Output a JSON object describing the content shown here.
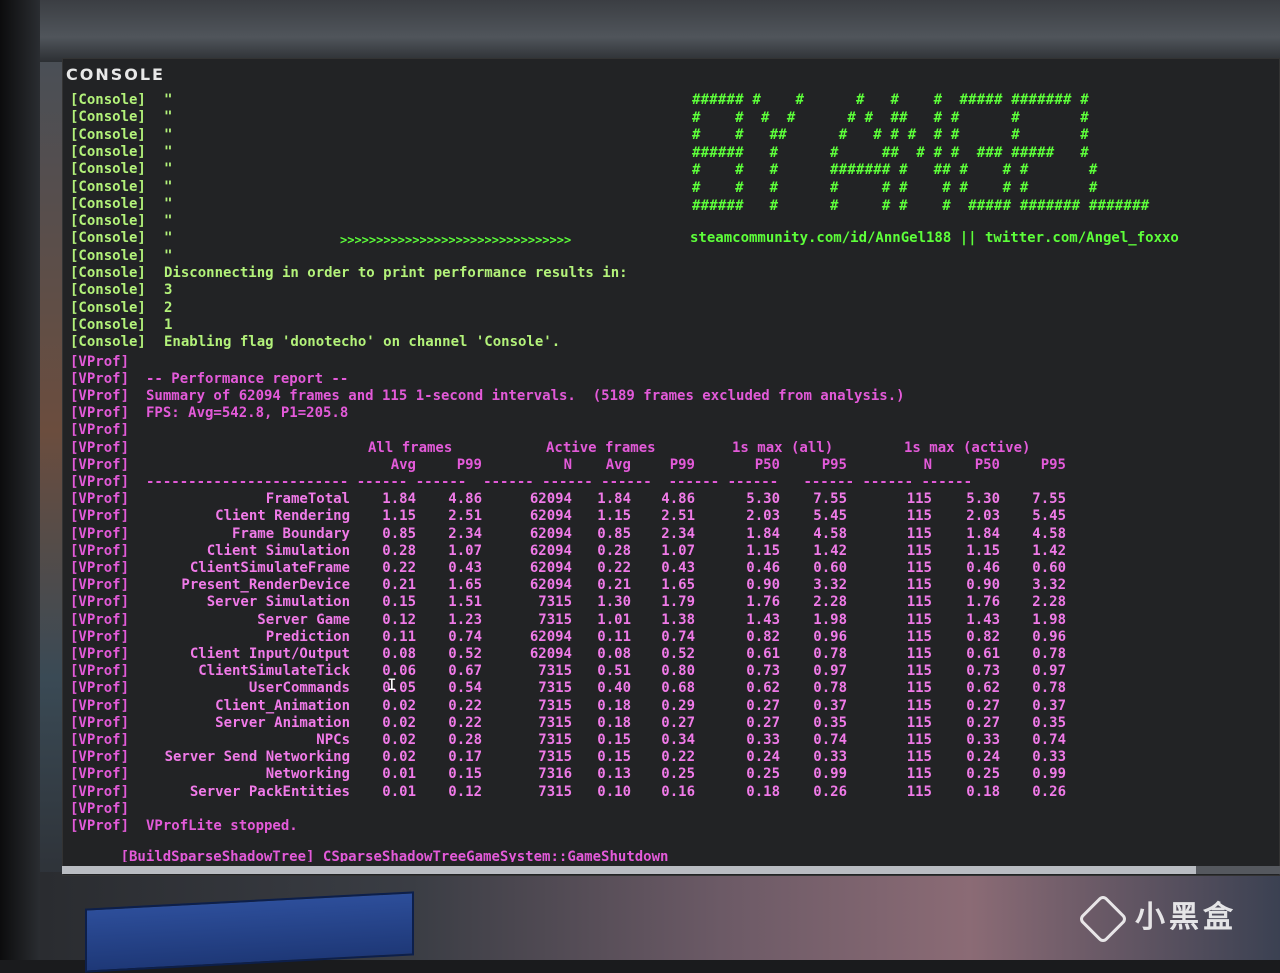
{
  "window": {
    "title": "CONSOLE"
  },
  "banner": {
    "art": [
      "###### #    #      #   #    #  ##### ####### #",
      "#    #  #  #      # #  ##   # #      #       #",
      "#    #   ##      #   # # #  # #      #       #",
      "######   #      #     ##  # # #  ### #####   #",
      "#    #   #      ####### #   ## #    # #       #",
      "#    #   #      #     # #    # #    # #       #",
      "######   #      #     # #    #  ##### ####### #######"
    ],
    "arrows": ">>>>>>>>>>>>>>>>>>>>>>>>>>>>>>>>",
    "links": "steamcommunity.com/id/AnnGel188 || twitter.com/Angel_foxxo"
  },
  "console_lines": [
    {
      "tag": "[Console]",
      "text": "\""
    },
    {
      "tag": "[Console]",
      "text": "\""
    },
    {
      "tag": "[Console]",
      "text": "\""
    },
    {
      "tag": "[Console]",
      "text": "\""
    },
    {
      "tag": "[Console]",
      "text": "\""
    },
    {
      "tag": "[Console]",
      "text": "\""
    },
    {
      "tag": "[Console]",
      "text": "\""
    },
    {
      "tag": "[Console]",
      "text": "\""
    },
    {
      "tag": "[Console]",
      "text": "\""
    },
    {
      "tag": "[Console]",
      "text": "\""
    },
    {
      "tag": "[Console]",
      "text": "Disconnecting in order to print performance results in:"
    },
    {
      "tag": "[Console]",
      "text": "3"
    },
    {
      "tag": "[Console]",
      "text": "2"
    },
    {
      "tag": "[Console]",
      "text": "1"
    },
    {
      "tag": "[Console]",
      "text": "Enabling flag 'donotecho' on channel 'Console'."
    }
  ],
  "vprof": {
    "tag": "[VProf]",
    "report_title": "-- Performance report --",
    "summary": "Summary of 62094 frames and 115 1-second intervals.  (5189 frames excluded from analysis.)",
    "fps": "FPS: Avg=542.8, P1=205.8",
    "group_headers": [
      "All frames",
      "Active frames",
      "1s max (all)",
      "1s max (active)"
    ],
    "col_headers": [
      "Avg",
      "P99",
      "N",
      "Avg",
      "P99",
      "P50",
      "P95",
      "N",
      "P50",
      "P95"
    ],
    "divider": "------------------------ ------ ------  ------ ------ ------  ------ ------   ------ ------ ------",
    "rows": [
      {
        "name": "FrameTotal",
        "v": [
          "1.84",
          "4.86",
          "62094",
          "1.84",
          "4.86",
          "5.30",
          "7.55",
          "115",
          "5.30",
          "7.55"
        ]
      },
      {
        "name": "Client Rendering",
        "v": [
          "1.15",
          "2.51",
          "62094",
          "1.15",
          "2.51",
          "2.03",
          "5.45",
          "115",
          "2.03",
          "5.45"
        ]
      },
      {
        "name": "Frame Boundary",
        "v": [
          "0.85",
          "2.34",
          "62094",
          "0.85",
          "2.34",
          "1.84",
          "4.58",
          "115",
          "1.84",
          "4.58"
        ]
      },
      {
        "name": "Client Simulation",
        "v": [
          "0.28",
          "1.07",
          "62094",
          "0.28",
          "1.07",
          "1.15",
          "1.42",
          "115",
          "1.15",
          "1.42"
        ]
      },
      {
        "name": "ClientSimulateFrame",
        "v": [
          "0.22",
          "0.43",
          "62094",
          "0.22",
          "0.43",
          "0.46",
          "0.60",
          "115",
          "0.46",
          "0.60"
        ]
      },
      {
        "name": "Present_RenderDevice",
        "v": [
          "0.21",
          "1.65",
          "62094",
          "0.21",
          "1.65",
          "0.90",
          "3.32",
          "115",
          "0.90",
          "3.32"
        ]
      },
      {
        "name": "Server Simulation",
        "v": [
          "0.15",
          "1.51",
          "7315",
          "1.30",
          "1.79",
          "1.76",
          "2.28",
          "115",
          "1.76",
          "2.28"
        ]
      },
      {
        "name": "Server Game",
        "v": [
          "0.12",
          "1.23",
          "7315",
          "1.01",
          "1.38",
          "1.43",
          "1.98",
          "115",
          "1.43",
          "1.98"
        ]
      },
      {
        "name": "Prediction",
        "v": [
          "0.11",
          "0.74",
          "62094",
          "0.11",
          "0.74",
          "0.82",
          "0.96",
          "115",
          "0.82",
          "0.96"
        ]
      },
      {
        "name": "Client Input/Output",
        "v": [
          "0.08",
          "0.52",
          "62094",
          "0.08",
          "0.52",
          "0.61",
          "0.78",
          "115",
          "0.61",
          "0.78"
        ]
      },
      {
        "name": "ClientSimulateTick",
        "v": [
          "0.06",
          "0.67",
          "7315",
          "0.51",
          "0.80",
          "0.73",
          "0.97",
          "115",
          "0.73",
          "0.97"
        ]
      },
      {
        "name": "UserCommands",
        "v": [
          "0.05",
          "0.54",
          "7315",
          "0.40",
          "0.68",
          "0.62",
          "0.78",
          "115",
          "0.62",
          "0.78"
        ]
      },
      {
        "name": "Client_Animation",
        "v": [
          "0.02",
          "0.22",
          "7315",
          "0.18",
          "0.29",
          "0.27",
          "0.37",
          "115",
          "0.27",
          "0.37"
        ]
      },
      {
        "name": "Server Animation",
        "v": [
          "0.02",
          "0.22",
          "7315",
          "0.18",
          "0.27",
          "0.27",
          "0.35",
          "115",
          "0.27",
          "0.35"
        ]
      },
      {
        "name": "NPCs",
        "v": [
          "0.02",
          "0.28",
          "7315",
          "0.15",
          "0.34",
          "0.33",
          "0.74",
          "115",
          "0.33",
          "0.74"
        ]
      },
      {
        "name": "Server Send Networking",
        "v": [
          "0.02",
          "0.17",
          "7315",
          "0.15",
          "0.22",
          "0.24",
          "0.33",
          "115",
          "0.24",
          "0.33"
        ]
      },
      {
        "name": "Networking",
        "v": [
          "0.01",
          "0.15",
          "7316",
          "0.13",
          "0.25",
          "0.25",
          "0.99",
          "115",
          "0.25",
          "0.99"
        ]
      },
      {
        "name": "Server PackEntities",
        "v": [
          "0.01",
          "0.12",
          "7315",
          "0.10",
          "0.16",
          "0.18",
          "0.26",
          "115",
          "0.18",
          "0.26"
        ]
      }
    ],
    "stopped": "VProfLite stopped."
  },
  "shutdown": {
    "tag": "[BuildSparseShadowTree]",
    "text": "CSparseShadowTreeGameSystem::GameShutdown"
  },
  "watermark": "小黑盒",
  "colors": {
    "console_text": "#b3f27a",
    "banner": "#5dff3a",
    "vprof": "#e35ad9",
    "background": "#222325"
  }
}
